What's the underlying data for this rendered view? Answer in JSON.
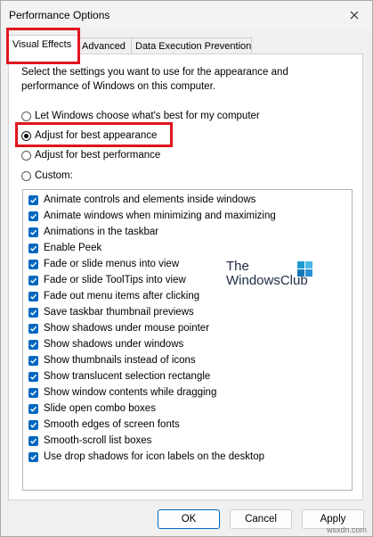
{
  "window": {
    "title": "Performance Options"
  },
  "tabs": [
    {
      "label": "Visual Effects"
    },
    {
      "label": "Advanced"
    },
    {
      "label": "Data Execution Prevention"
    }
  ],
  "panel": {
    "description": "Select the settings you want to use for the appearance and performance of Windows on this computer."
  },
  "radios": [
    {
      "label": "Let Windows choose what's best for my computer",
      "checked": false
    },
    {
      "label": "Adjust for best appearance",
      "checked": true
    },
    {
      "label": "Adjust for best performance",
      "checked": false
    },
    {
      "label": "Custom:",
      "checked": false
    }
  ],
  "effects": [
    {
      "label": "Animate controls and elements inside windows",
      "checked": true
    },
    {
      "label": "Animate windows when minimizing and maximizing",
      "checked": true
    },
    {
      "label": "Animations in the taskbar",
      "checked": true
    },
    {
      "label": "Enable Peek",
      "checked": true
    },
    {
      "label": "Fade or slide menus into view",
      "checked": true
    },
    {
      "label": "Fade or slide ToolTips into view",
      "checked": true
    },
    {
      "label": "Fade out menu items after clicking",
      "checked": true
    },
    {
      "label": "Save taskbar thumbnail previews",
      "checked": true
    },
    {
      "label": "Show shadows under mouse pointer",
      "checked": true
    },
    {
      "label": "Show shadows under windows",
      "checked": true
    },
    {
      "label": "Show thumbnails instead of icons",
      "checked": true
    },
    {
      "label": "Show translucent selection rectangle",
      "checked": true
    },
    {
      "label": "Show window contents while dragging",
      "checked": true
    },
    {
      "label": "Slide open combo boxes",
      "checked": true
    },
    {
      "label": "Smooth edges of screen fonts",
      "checked": true
    },
    {
      "label": "Smooth-scroll list boxes",
      "checked": true
    },
    {
      "label": "Use drop shadows for icon labels on the desktop",
      "checked": true
    }
  ],
  "watermark": {
    "line1": "The",
    "line2": "WindowsClub"
  },
  "buttons": {
    "ok": "OK",
    "cancel": "Cancel",
    "apply": "Apply"
  },
  "corner_text": "wsxdn.com",
  "colors": {
    "accent": "#0067c0",
    "highlight": "#e0151e"
  }
}
